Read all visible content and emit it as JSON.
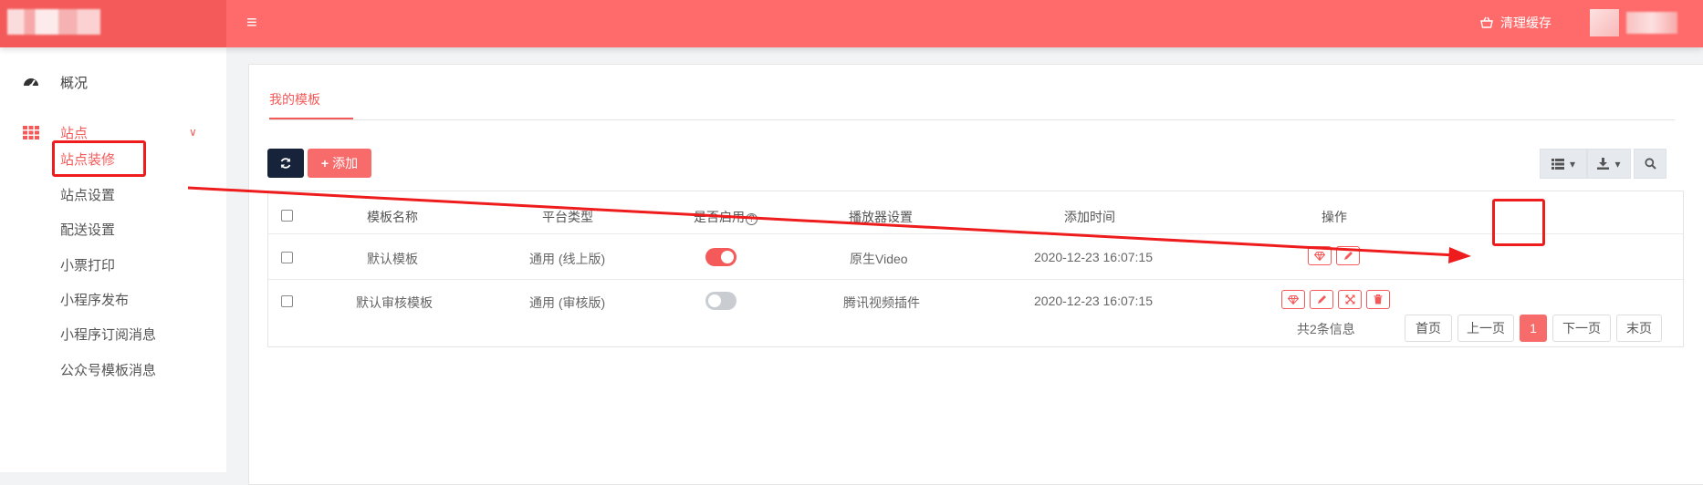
{
  "header": {
    "menu_icon": "hamburger-icon",
    "clear_cache_label": "清理缓存",
    "clear_cache_icon": "basket-icon"
  },
  "sidebar": {
    "items": [
      {
        "label": "概况",
        "icon": "dashboard-icon"
      },
      {
        "label": "站点",
        "icon": "grid-icon",
        "expanded": true
      }
    ],
    "sub_items": [
      {
        "label": "站点装修",
        "active": true
      },
      {
        "label": "站点设置"
      },
      {
        "label": "配送设置"
      },
      {
        "label": "小票打印"
      },
      {
        "label": "小程序发布"
      },
      {
        "label": "小程序订阅消息"
      },
      {
        "label": "公众号模板消息"
      }
    ]
  },
  "tabs": [
    {
      "label": "我的模板",
      "active": true
    }
  ],
  "toolbar": {
    "refresh_icon": "refresh-icon",
    "add_label": "添加",
    "add_icon": "plus-icon",
    "view_icon": "list-icon",
    "export_icon": "download-icon",
    "search_icon": "search-icon"
  },
  "table": {
    "headers": [
      "模板名称",
      "平台类型",
      "是否启用",
      "播放器设置",
      "添加时间",
      "操作"
    ],
    "enabled_help_icon": "question-circle-icon",
    "rows": [
      {
        "name": "默认模板",
        "platform": "通用 (线上版)",
        "enabled": true,
        "player": "原生Video",
        "time": "2020-12-23 16:07:15"
      },
      {
        "name": "默认审核模板",
        "platform": "通用 (审核版)",
        "enabled": false,
        "player": "腾讯视频插件",
        "time": "2020-12-23 16:07:15"
      }
    ]
  },
  "pagination": {
    "info": "共2条信息",
    "first": "首页",
    "prev": "上一页",
    "current": "1",
    "next": "下一页",
    "last": "末页"
  },
  "colors": {
    "accent": "#f45a5a",
    "header": "#ff6a6a",
    "dark_button": "#17233a",
    "annotation": "#ee1c1c"
  }
}
